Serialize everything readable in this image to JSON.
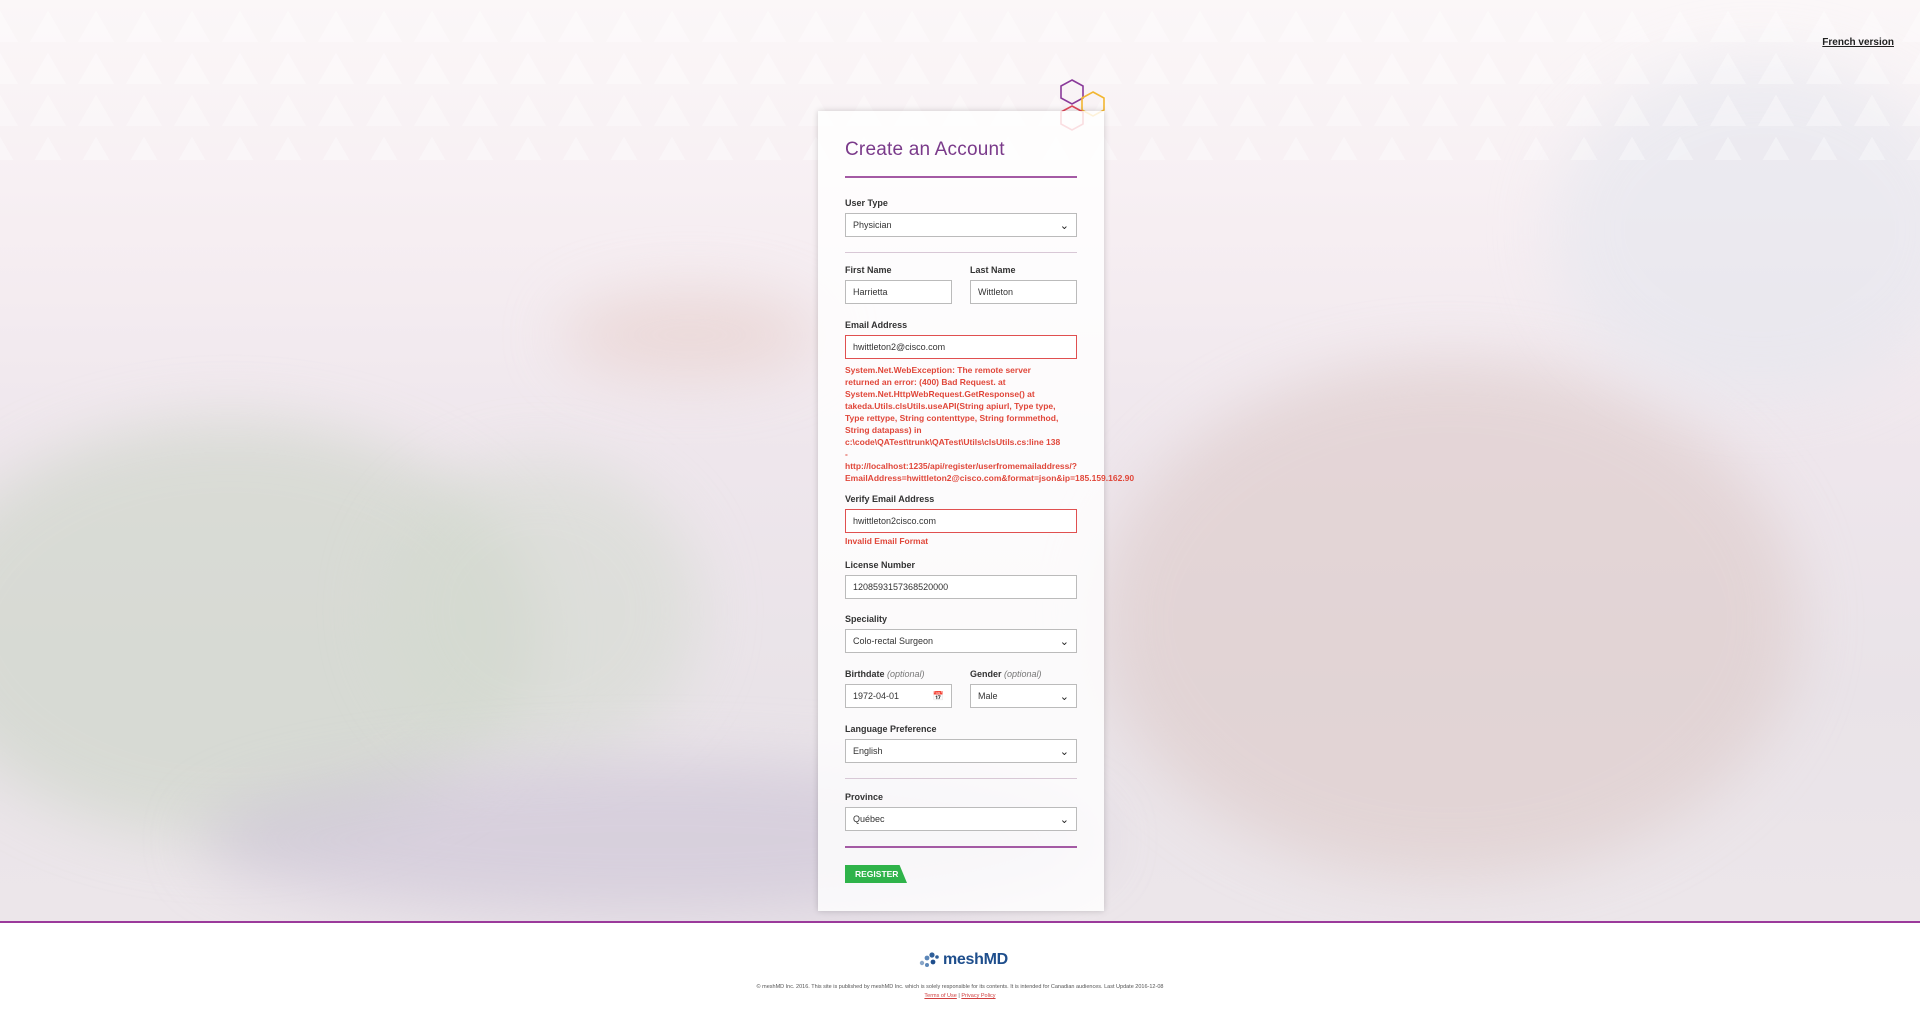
{
  "header": {
    "language_link": "French version"
  },
  "form": {
    "title": "Create an Account",
    "user_type": {
      "label": "User Type",
      "value": "Physician"
    },
    "first_name": {
      "label": "First Name",
      "value": "Harrietta"
    },
    "last_name": {
      "label": "Last Name",
      "value": "Wittleton"
    },
    "email": {
      "label": "Email Address",
      "value": "hwittleton2@cisco.com",
      "error_lines": [
        "System.Net.WebException: The remote server",
        "returned an error: (400) Bad Request. at",
        "System.Net.HttpWebRequest.GetResponse() at",
        "takeda.Utils.clsUtils.useAPI(String apiurl, Type type,",
        "Type rettype, String contenttype, String formmethod,",
        "String datapass) in",
        "c:\\code\\QATest\\trunk\\QATest\\Utils\\clsUtils.cs:line 138",
        "-",
        "http://localhost:1235/api/register/userfromemailaddress/?",
        "EmailAddress=hwittleton2@cisco.com&format=json&ip=185.159.162.90"
      ]
    },
    "verify_email": {
      "label": "Verify Email Address",
      "value": "hwittleton2cisco.com",
      "error": "Invalid Email Format"
    },
    "license": {
      "label": "License Number",
      "value": "1208593157368520000"
    },
    "speciality": {
      "label": "Speciality",
      "value": "Colo-rectal Surgeon"
    },
    "birthdate": {
      "label": "Birthdate",
      "optional": "(optional)",
      "value": "1972-04-01"
    },
    "gender": {
      "label": "Gender",
      "optional": "(optional)",
      "value": "Male"
    },
    "language": {
      "label": "Language Preference",
      "value": "English"
    },
    "province": {
      "label": "Province",
      "value": "Québec"
    },
    "register_label": "REGISTER"
  },
  "footer": {
    "brand": "meshMD",
    "copyright": "© meshMD Inc. 2016. This site is published by meshMD Inc. which is solely responsible for its contents. It is intended for Canadian audiences. Last Update 2016-12-08",
    "terms": "Terms of Use",
    "separator": "|",
    "privacy": "Privacy Policy"
  },
  "colors": {
    "accent": "#7a3a8a",
    "error": "#e0473a",
    "register": "#2fb34a",
    "brand": "#1e4e8c"
  },
  "icons": {
    "select": "chevron-down-icon",
    "date": "calendar-icon"
  }
}
